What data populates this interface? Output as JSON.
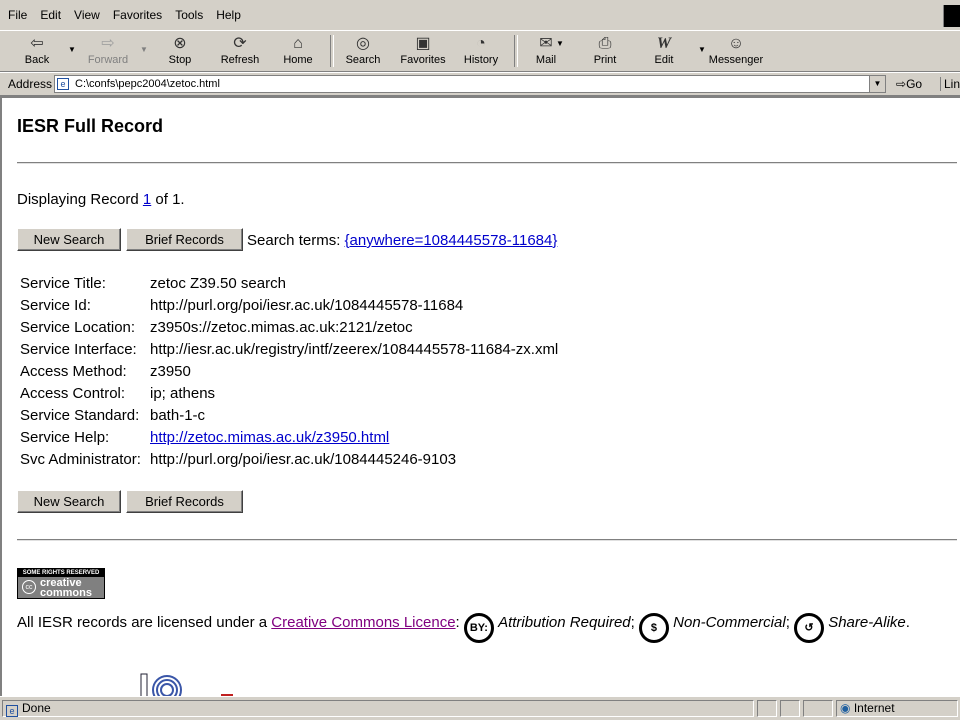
{
  "menu": [
    "File",
    "Edit",
    "View",
    "Favorites",
    "Tools",
    "Help"
  ],
  "toolbar": {
    "back": "Back",
    "forward": "Forward",
    "stop": "Stop",
    "refresh": "Refresh",
    "home": "Home",
    "search": "Search",
    "favorites": "Favorites",
    "history": "History",
    "mail": "Mail",
    "print": "Print",
    "edit": "Edit",
    "messenger": "Messenger"
  },
  "address": {
    "label": "Address",
    "url": "C:\\confs\\pepc2004\\zetoc.html",
    "go": "Go",
    "links": "Links"
  },
  "page": {
    "title": "IESR Full Record",
    "display_prefix": "Displaying Record ",
    "display_num": "1",
    "display_suffix": " of 1.",
    "new_search": "New Search",
    "brief_records": "Brief Records",
    "search_terms_label": "Search terms: ",
    "search_terms_value": "{anywhere=1084445578-11684}",
    "record": [
      {
        "key": "Service Title:",
        "value": "zetoc Z39.50 search"
      },
      {
        "key": "Service Id:",
        "value": "http://purl.org/poi/iesr.ac.uk/1084445578-11684"
      },
      {
        "key": "Service Location:",
        "value": "z3950s://zetoc.mimas.ac.uk:2121/zetoc"
      },
      {
        "key": "Service Interface:",
        "value": "http://iesr.ac.uk/registry/intf/zeerex/1084445578-11684-zx.xml"
      },
      {
        "key": "Access Method:",
        "value": "z3950"
      },
      {
        "key": "Access Control:",
        "value": "ip; athens"
      },
      {
        "key": "Service Standard:",
        "value": "bath-1-c"
      },
      {
        "key": "Service Help:",
        "value": "http://zetoc.mimas.ac.uk/z3950.html"
      },
      {
        "key": "Svc Administrator:",
        "value": "http://purl.org/poi/iesr.ac.uk/1084445246-9103"
      }
    ],
    "cc_badge_top": "SOME RIGHTS RESERVED",
    "cc_badge_word": "creative commons",
    "licence_prefix": "All IESR records are licensed under a ",
    "licence_link": "Creative Commons Licence",
    "licence_colon": ": ",
    "attribution": "Attribution Required",
    "noncommercial": "Non-Commercial",
    "sharealike": "Share-Alike",
    "sep": "; ",
    "end": "."
  },
  "status": {
    "left": "Done",
    "zone": "Internet"
  }
}
